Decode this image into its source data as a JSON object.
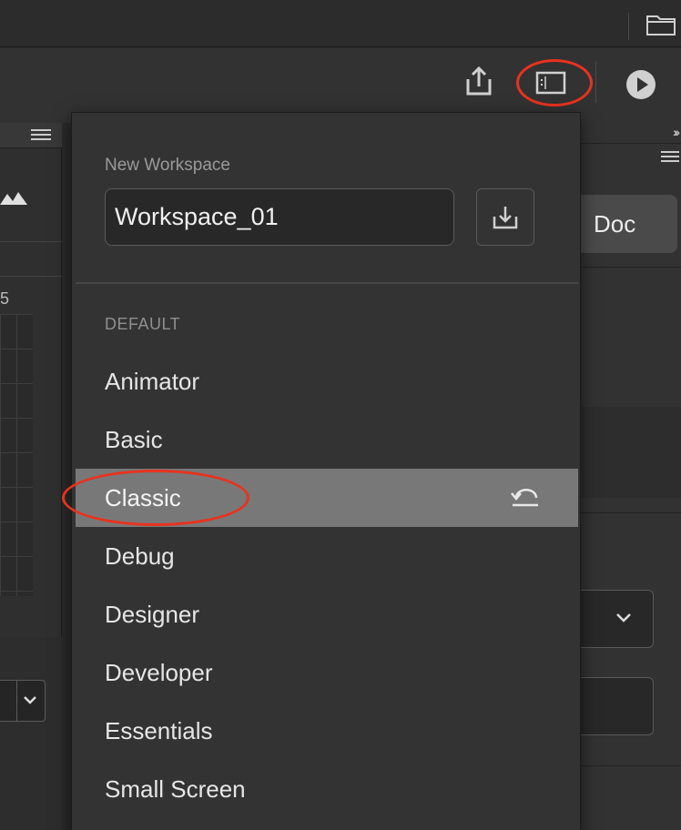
{
  "colors": {
    "accent_annotation": "#e8321e",
    "popup_bg": "#333333",
    "selected_item_bg": "#787878"
  },
  "toolbar": {
    "icons": [
      "share-icon",
      "workspace-switcher-icon",
      "play-icon",
      "folder-icon"
    ]
  },
  "left_panel": {
    "ruler_label": "5"
  },
  "right_panel": {
    "doc_tab_label": "Doc"
  },
  "workspace_popup": {
    "new_workspace_label": "New Workspace",
    "new_workspace_value": "Workspace_01",
    "section_label": "DEFAULT",
    "items": [
      {
        "label": "Animator",
        "selected": false
      },
      {
        "label": "Basic",
        "selected": false
      },
      {
        "label": "Classic",
        "selected": true
      },
      {
        "label": "Debug",
        "selected": false
      },
      {
        "label": "Designer",
        "selected": false
      },
      {
        "label": "Developer",
        "selected": false
      },
      {
        "label": "Essentials",
        "selected": false
      },
      {
        "label": "Small Screen",
        "selected": false
      }
    ]
  }
}
